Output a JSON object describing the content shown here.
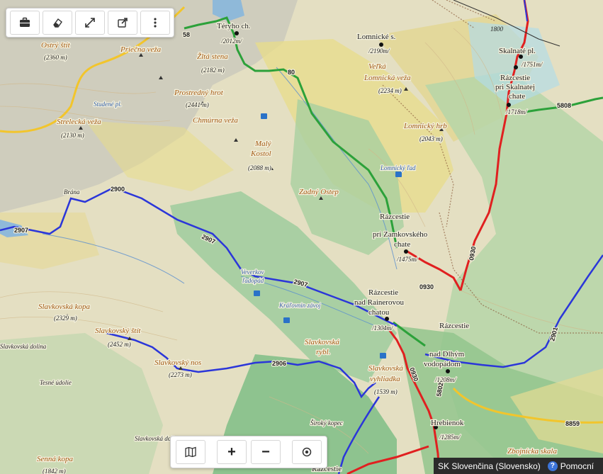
{
  "toolbar": {
    "buttons": [
      {
        "name": "briefcase-icon"
      },
      {
        "name": "eraser-icon"
      },
      {
        "name": "fullscreen-icon"
      },
      {
        "name": "external-link-icon"
      },
      {
        "name": "more-vertical-icon"
      }
    ]
  },
  "zoombar": {
    "plus": "+",
    "minus": "−",
    "icons": [
      "map-layers-icon",
      "locate-icon"
    ]
  },
  "status": {
    "language": "SK Slovenčina (Slovensko)",
    "help_symbol": "?",
    "help_label": "Pomocní"
  },
  "map": {
    "places": {
      "teryho_name": "Téryho ch.",
      "teryho_elev": "/2012m/",
      "lomnicke_name": "Lomnické s.",
      "lomnicke_elev": "/2190m/",
      "skalnate_name": "Skalnaté pl.",
      "skalnate_elev": "/1751m/",
      "rsk_1": "Rázcestie",
      "rsk_2": "pri Skalnatej",
      "rsk_3": "chate",
      "rsk_elev": "/1718m/",
      "rzam_1": "Rázcestie",
      "rzam_2": "pri Zamkovského",
      "rzam_3": "chate",
      "rzam_elev": "/1475m/",
      "rrain_1": "Rázcestie",
      "rrain_2": "nad Rainerovou",
      "rrain_3": "chatou",
      "rrain_elev": "/1304m/",
      "rdlh_1": "Rázcestie",
      "rdlh_2": "nad Dlhým",
      "rdlh_3": "vodopádom",
      "rdlh_elev": "/1208m/",
      "hrebienok_name": "Hrebienok",
      "hrebienok_elev": "/1285m/",
      "razcestie_bottom": "Rázcestie",
      "brana": "Brána",
      "slavkovska_dolina": "Slavkovská dolina",
      "tesne_udolie": "Tesné údolie",
      "siroky_kopec": "Široký kopec",
      "slavkovska_dolina_2": "Slavkovská dolina",
      "top_partial": "om"
    },
    "peaks": {
      "ostry": "Ostrý štít",
      "ostry_elev": "(2360 m)",
      "prielom": "Priečna veža",
      "zlta": "Žltá stena",
      "zlta_elev": "(2182 m)",
      "prostredny": "Prostredný hrot",
      "prostredny_elev": "(2441 m)",
      "chmurna": "Chmúrna veža",
      "maly_1": "Malý",
      "maly_2": "Kostol",
      "maly_elev": "(2088 m)",
      "zadny": "Zadný Ostep",
      "strelecka": "Strelecká veža",
      "strelecka_elev": "(2130 m)",
      "velka_1": "Veľká",
      "velka_2": "Lomnická veža",
      "velka_elev": "(2234 m)",
      "lomnicky_hreben": "Lomnický hrb",
      "lomnicky_elev": "(2043 m)",
      "slavkovska_kopa": "Slavkovská kopa",
      "slavkovska_kopa_elev": "(2329 m)",
      "slavkovsky_stit": "Slavkovský štít",
      "slavkovsky_stit_elev": "(2452 m)",
      "slavkovsky_nos": "Slavkovský nos",
      "slavkovsky_nos_elev": "(2273 m)",
      "slav_ryb_1": "Slavkovská",
      "slav_ryb_2": "rybl.",
      "slav_vyh_1": "Slavkovská",
      "slav_vyh_2": "vyhliadka",
      "slav_vyh_elev": "(1539 m)",
      "senna": "Senná kopa",
      "senna_elev": "(1842 m)",
      "zbojnicka": "Zbojnícka skala"
    },
    "water": {
      "studene": "Studené pl.",
      "lomnicky_lad": "Lomnický ľad",
      "veverkov_1": "Veverkov",
      "veverkov_2": "ľadopád",
      "kralovnin": "Kráľovnin závoj"
    },
    "routes": {
      "r2907a": "2907",
      "r2907b": "2907",
      "r2907c": "2907",
      "r2906": "2906",
      "r2901": "2901",
      "r0930a": "0930",
      "r0930b": "0930",
      "r0930c": "0930",
      "r5808": "5808",
      "r8859": "8859",
      "r80": "80",
      "r58": "58",
      "r2900": "2900",
      "r5802": "5802",
      "r1800": "1800"
    }
  }
}
